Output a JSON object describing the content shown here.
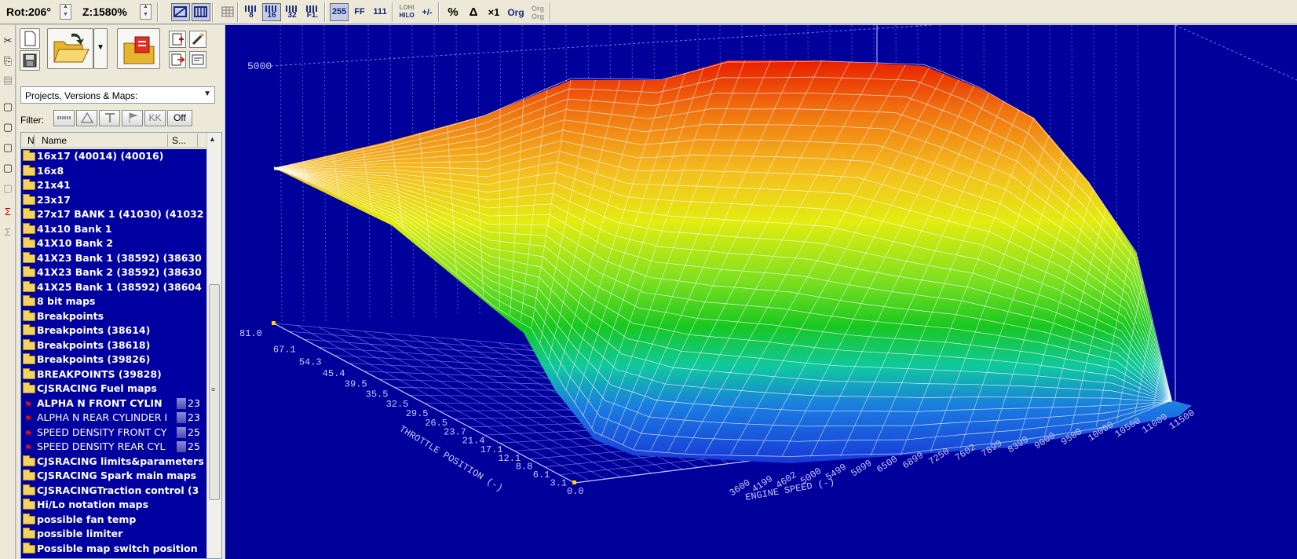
{
  "toolbar": {
    "rotation": "Rot:206°",
    "zoom": "Z:1580%",
    "res_8": "8",
    "res_16": "16",
    "res_32": "32",
    "res_fl": "F1.",
    "fmt_255": "255",
    "fmt_ff": "FF",
    "fmt_111": "111",
    "hilo_top": "LOHI",
    "hilo_bottom": "HILO",
    "sign": "+/-",
    "percent": "%",
    "delta": "Δ",
    "times_one": "×1",
    "org": "Org",
    "org2_top": "Org",
    "org2_bottom": "Org"
  },
  "panel": {
    "combo_label": "Projects, Versions & Maps:",
    "filter_label": "Filter:",
    "filter_buttons": [
      "KK",
      "Off"
    ],
    "columns": {
      "n": "N",
      "name": "Name",
      "s": "S..."
    },
    "items": [
      {
        "type": "folder",
        "label": "16x17 (40014) (40016)"
      },
      {
        "type": "folder",
        "label": "16x8"
      },
      {
        "type": "folder",
        "label": "21x41"
      },
      {
        "type": "folder",
        "label": "23x17"
      },
      {
        "type": "folder",
        "label": "27x17 BANK 1 (41030) (41032"
      },
      {
        "type": "folder",
        "label": "41x10 Bank 1"
      },
      {
        "type": "folder",
        "label": "41X10 Bank 2"
      },
      {
        "type": "folder",
        "label": "41X23 Bank 1 (38592) (38630"
      },
      {
        "type": "folder",
        "label": "41X23 Bank 2 (38592) (38630"
      },
      {
        "type": "folder",
        "label": "41X25 Bank 1 (38592) (38604"
      },
      {
        "type": "folder",
        "label": "8 bit maps"
      },
      {
        "type": "folder",
        "label": "Breakpoints"
      },
      {
        "type": "folder",
        "label": "Breakpoints (38614)"
      },
      {
        "type": "folder",
        "label": "Breakpoints (38618)"
      },
      {
        "type": "folder",
        "label": "Breakpoints (39826)"
      },
      {
        "type": "folder",
        "label": "BREAKPOINTS (39828)"
      },
      {
        "type": "folder",
        "label": "CJSRACING Fuel maps"
      },
      {
        "type": "map",
        "selected": true,
        "label": "ALPHA N FRONT CYLIN",
        "size": "23"
      },
      {
        "type": "map",
        "label": "ALPHA N REAR CYLINDER I",
        "size": "23"
      },
      {
        "type": "map",
        "label": "SPEED DENSITY FRONT CY",
        "size": "25"
      },
      {
        "type": "map",
        "label": "SPEED DENSITY REAR CYL",
        "size": "25"
      },
      {
        "type": "folder",
        "label": "CJSRACING limits&parameters"
      },
      {
        "type": "folder",
        "label": "CJSRACING Spark main maps"
      },
      {
        "type": "folder",
        "label": "CJSRACINGTraction control (3"
      },
      {
        "type": "folder",
        "label": "Hi/Lo notation maps"
      },
      {
        "type": "folder",
        "label": "possible fan temp"
      },
      {
        "type": "folder",
        "label": "possible limiter"
      },
      {
        "type": "folder",
        "label": "Possible map switch position"
      }
    ]
  },
  "view3d": {
    "z_label": "5000",
    "throttle_ticks": [
      "81.0",
      "67.1",
      "54.3",
      "45.4",
      "39.5",
      "35.5",
      "32.5",
      "29.5",
      "26.5",
      "23.7",
      "21.4",
      "17.1",
      "12.1",
      "8.8",
      "6.1",
      "3.1",
      "0.0"
    ],
    "rpm_ticks": [
      "3600",
      "4199",
      "4602",
      "5000",
      "5499",
      "5899",
      "6500",
      "6899",
      "7250",
      "7602",
      "7899",
      "8399",
      "9000",
      "9500",
      "10000",
      "10500",
      "11000",
      "11500"
    ],
    "throttle_axis_label": "THROTTLE POSITION (-)",
    "rpm_axis_label": "ENGINE SPEED (-)"
  },
  "colors": {
    "view_background": "#00009b",
    "list_background": "#0000a0",
    "grid_line": "#c8c8ff",
    "mesh_line": "#ffffff"
  },
  "icons": [
    "cut-icon",
    "copy-icon",
    "paste-icon",
    "new-file-icon",
    "save-icon",
    "open-folder-icon",
    "import-icon",
    "compare-icon",
    "checksum-icon"
  ]
}
